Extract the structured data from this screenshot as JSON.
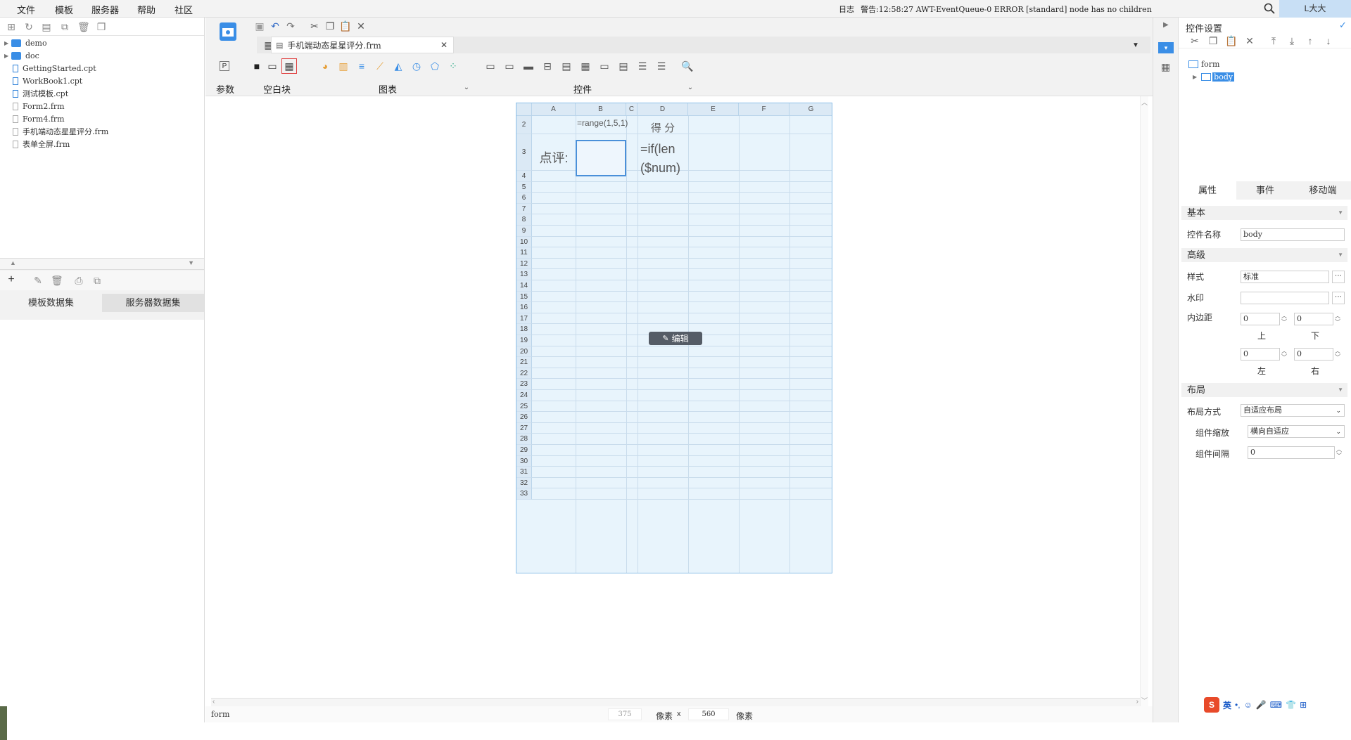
{
  "menubar": {
    "items": [
      "文件",
      "模板",
      "服务器",
      "帮助",
      "社区"
    ],
    "log_label": "日志",
    "log_message": "警告:12:58:27 AWT-EventQueue-0 ERROR [standard] node has no children",
    "user": "L大大"
  },
  "file_tree": {
    "items": [
      {
        "label": "demo",
        "type": "folder"
      },
      {
        "label": "doc",
        "type": "folder"
      },
      {
        "label": "GettingStarted.cpt",
        "type": "cpt"
      },
      {
        "label": "WorkBook1.cpt",
        "type": "cpt"
      },
      {
        "label": "测试模板.cpt",
        "type": "cpt"
      },
      {
        "label": "Form2.frm",
        "type": "frm"
      },
      {
        "label": "Form4.frm",
        "type": "frm"
      },
      {
        "label": "手机端动态星星评分.frm",
        "type": "frm"
      },
      {
        "label": "表单全屏.frm",
        "type": "frm"
      }
    ]
  },
  "dataset_tabs": [
    "模板数据集",
    "服务器数据集"
  ],
  "editor": {
    "tab_title": "手机端动态星星评分.frm",
    "groups": {
      "param": "参数",
      "blank": "空白块",
      "chart": "图表",
      "widget": "控件"
    }
  },
  "sheet": {
    "columns": [
      "A",
      "B",
      "C",
      "D",
      "E",
      "F",
      "G"
    ],
    "rows": [
      "2",
      "3",
      "4",
      "5",
      "6",
      "7",
      "8",
      "9",
      "10",
      "11",
      "12",
      "13",
      "14",
      "15",
      "16",
      "17",
      "18",
      "19",
      "20",
      "21",
      "22",
      "23",
      "24",
      "25",
      "26",
      "27",
      "28",
      "29",
      "30",
      "31",
      "32",
      "33"
    ],
    "cells": {
      "b2": "=range(1,5,1)",
      "d2": "得 分",
      "a3": "点评:",
      "d3": "=if(len($num)"
    },
    "edit_button": "编辑"
  },
  "status": {
    "left": "form",
    "width": "375",
    "unit1": "像素",
    "x": "x",
    "height": "560",
    "unit2": "像素"
  },
  "right_panel": {
    "title": "控件设置",
    "tree": {
      "root": "form",
      "child": "body"
    },
    "tabs": [
      "属性",
      "事件",
      "移动端"
    ],
    "sections": {
      "basic": "基本",
      "advanced": "高级",
      "layout": "布局"
    },
    "labels": {
      "widget_name": "控件名称",
      "style": "样式",
      "watermark": "水印",
      "padding": "内边距",
      "top": "上",
      "bottom": "下",
      "left": "左",
      "right": "右",
      "layout_mode": "布局方式",
      "widget_scale": "组件缩放",
      "widget_gap": "组件间隔"
    },
    "values": {
      "widget_name": "body",
      "style": "标准",
      "watermark": "",
      "pad_top": "0",
      "pad_bottom": "0",
      "pad_left": "0",
      "pad_right": "0",
      "layout_mode": "自适应布局",
      "widget_scale": "横向自适应",
      "widget_gap": "0"
    }
  },
  "ime": {
    "lang": "英"
  },
  "colors": {
    "accent": "#3a8ee6",
    "sheet_bg": "#e8f4fc",
    "selection": "#4a90d9"
  }
}
